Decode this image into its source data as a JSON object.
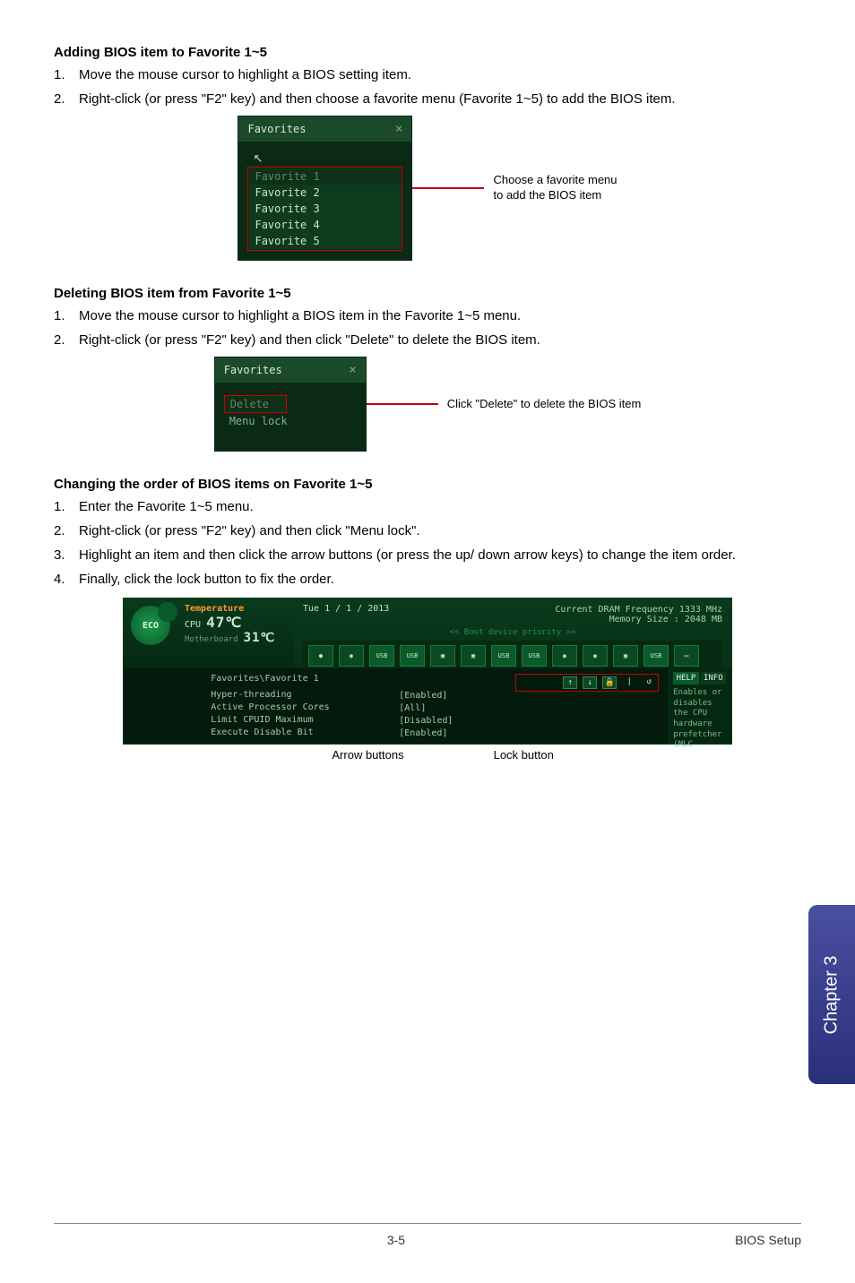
{
  "sections": {
    "add": {
      "heading": "Adding BIOS item to Favorite 1~5",
      "step1": "Move the mouse cursor to highlight a BIOS setting item.",
      "step2": "Right-click (or press \"F2\" key) and then choose a favorite menu (Favorite 1~5) to add the BIOS item.",
      "callout_l1": "Choose a favorite menu",
      "callout_l2": "to add the BIOS item"
    },
    "del": {
      "heading": "Deleting BIOS item from Favorite 1~5",
      "step1": "Move the mouse cursor to highlight a BIOS item in the Favorite 1~5 menu.",
      "step2": "Right-click (or press \"F2\" key) and then click \"Delete\" to delete the BIOS item.",
      "callout": "Click \"Delete\" to delete the BIOS item"
    },
    "order": {
      "heading": "Changing the order of BIOS items on Favorite 1~5",
      "step1": "Enter the Favorite 1~5 menu.",
      "step2": "Right-click (or press \"F2\" key) and then click \"Menu lock\".",
      "step3": "Highlight an item and then click the arrow buttons (or press the up/ down arrow keys) to change the item order.",
      "step4": "Finally, click the lock button to fix the order."
    }
  },
  "popup": {
    "title": "Favorites",
    "close": "×",
    "items": [
      "Favorite 1",
      "Favorite 2",
      "Favorite 3",
      "Favorite 4",
      "Favorite 5"
    ],
    "delete_label": "Delete",
    "menulock_label": "Menu lock"
  },
  "bios": {
    "temperature_label": "Temperature",
    "cpu_label": "CPU",
    "mb_label": "Motherboard",
    "cpu_temp": "47℃",
    "mb_temp": "31℃",
    "eco": "ECO",
    "date": "Tue  1 / 1 / 2013",
    "dram": "Current DRAM Frequency 1333 MHz",
    "mem": "Memory Size : 2048 MB",
    "boot_label": "<< Boot device priority >>",
    "usb": "USB",
    "path": "Favorites\\Favorite 1",
    "opts": [
      {
        "k": "Hyper-threading",
        "v": "[Enabled]"
      },
      {
        "k": "Active Processor Cores",
        "v": "[All]"
      },
      {
        "k": "Limit CPUID Maximum",
        "v": "[Disabled]"
      },
      {
        "k": "Execute Disable Bit",
        "v": "[Enabled]"
      }
    ],
    "help_tab": "HELP",
    "info_tab": "INFO",
    "help_body": "Enables or disables the CPU hardware prefetcher (MLC",
    "arrow_glyphs": {
      "up": "↑",
      "down": "↓",
      "lock": "🔒",
      "undo": "↺"
    },
    "labels": {
      "arrows": "Arrow buttons",
      "lock": "Lock button"
    }
  },
  "chapter": "Chapter 3",
  "footer": {
    "page": "3-5",
    "section": "BIOS Setup"
  }
}
